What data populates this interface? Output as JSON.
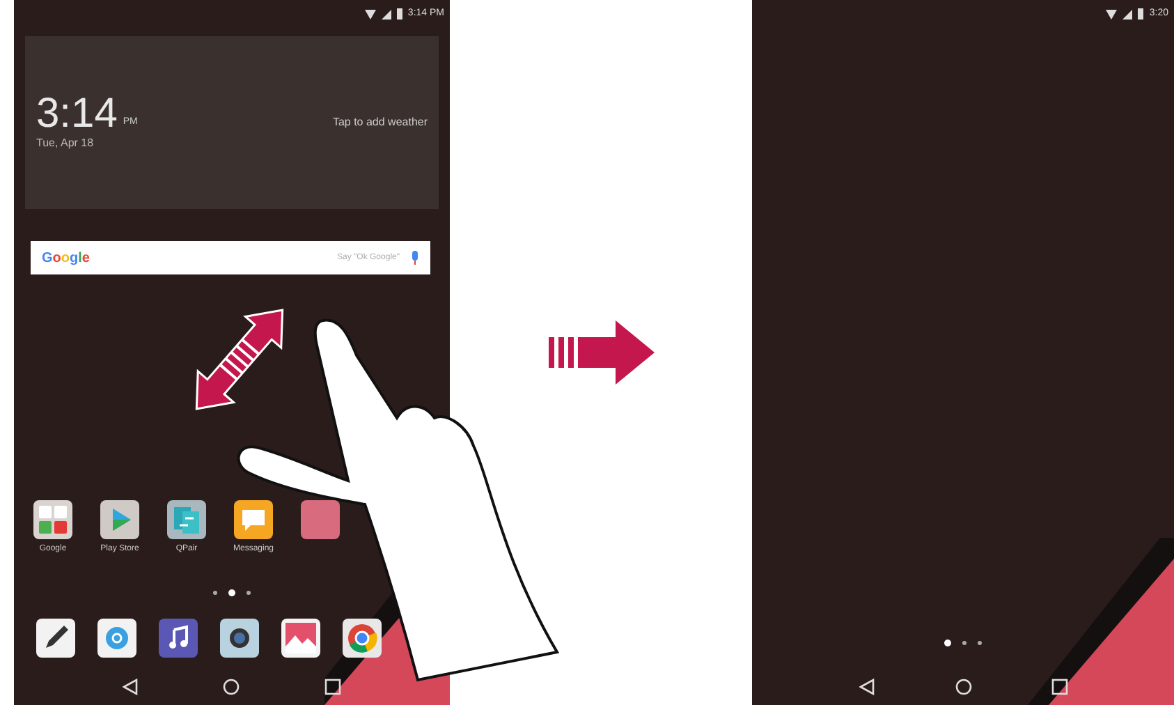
{
  "screens": [
    {
      "status_time": "3:14 PM",
      "clock": {
        "time": "3:14",
        "ampm": "PM",
        "date": "Tue, Apr 18"
      },
      "weather_hint": "Tap to add weather",
      "search": {
        "logo": "Google",
        "placeholder": "Say \"Ok Google\""
      },
      "apps": [
        {
          "kind": "folder",
          "label": "Google"
        },
        {
          "kind": "play",
          "label": "Play Store"
        },
        {
          "kind": "swap",
          "label": "QPair"
        },
        {
          "kind": "chat",
          "label": "Messaging"
        },
        {
          "kind": "pink"
        }
      ],
      "page_dots": [
        {
          "selected": false
        },
        {
          "selected": true
        },
        {
          "selected": false
        }
      ],
      "dock": [
        {
          "kind": "pen"
        },
        {
          "kind": "at"
        },
        {
          "kind": "music"
        },
        {
          "kind": "camera"
        },
        {
          "kind": "gallery"
        },
        {
          "kind": "chrome"
        }
      ]
    },
    {
      "status_time": "3:20",
      "page_dots": [
        {
          "selected": true
        },
        {
          "selected": false
        },
        {
          "selected": false
        }
      ]
    }
  ]
}
